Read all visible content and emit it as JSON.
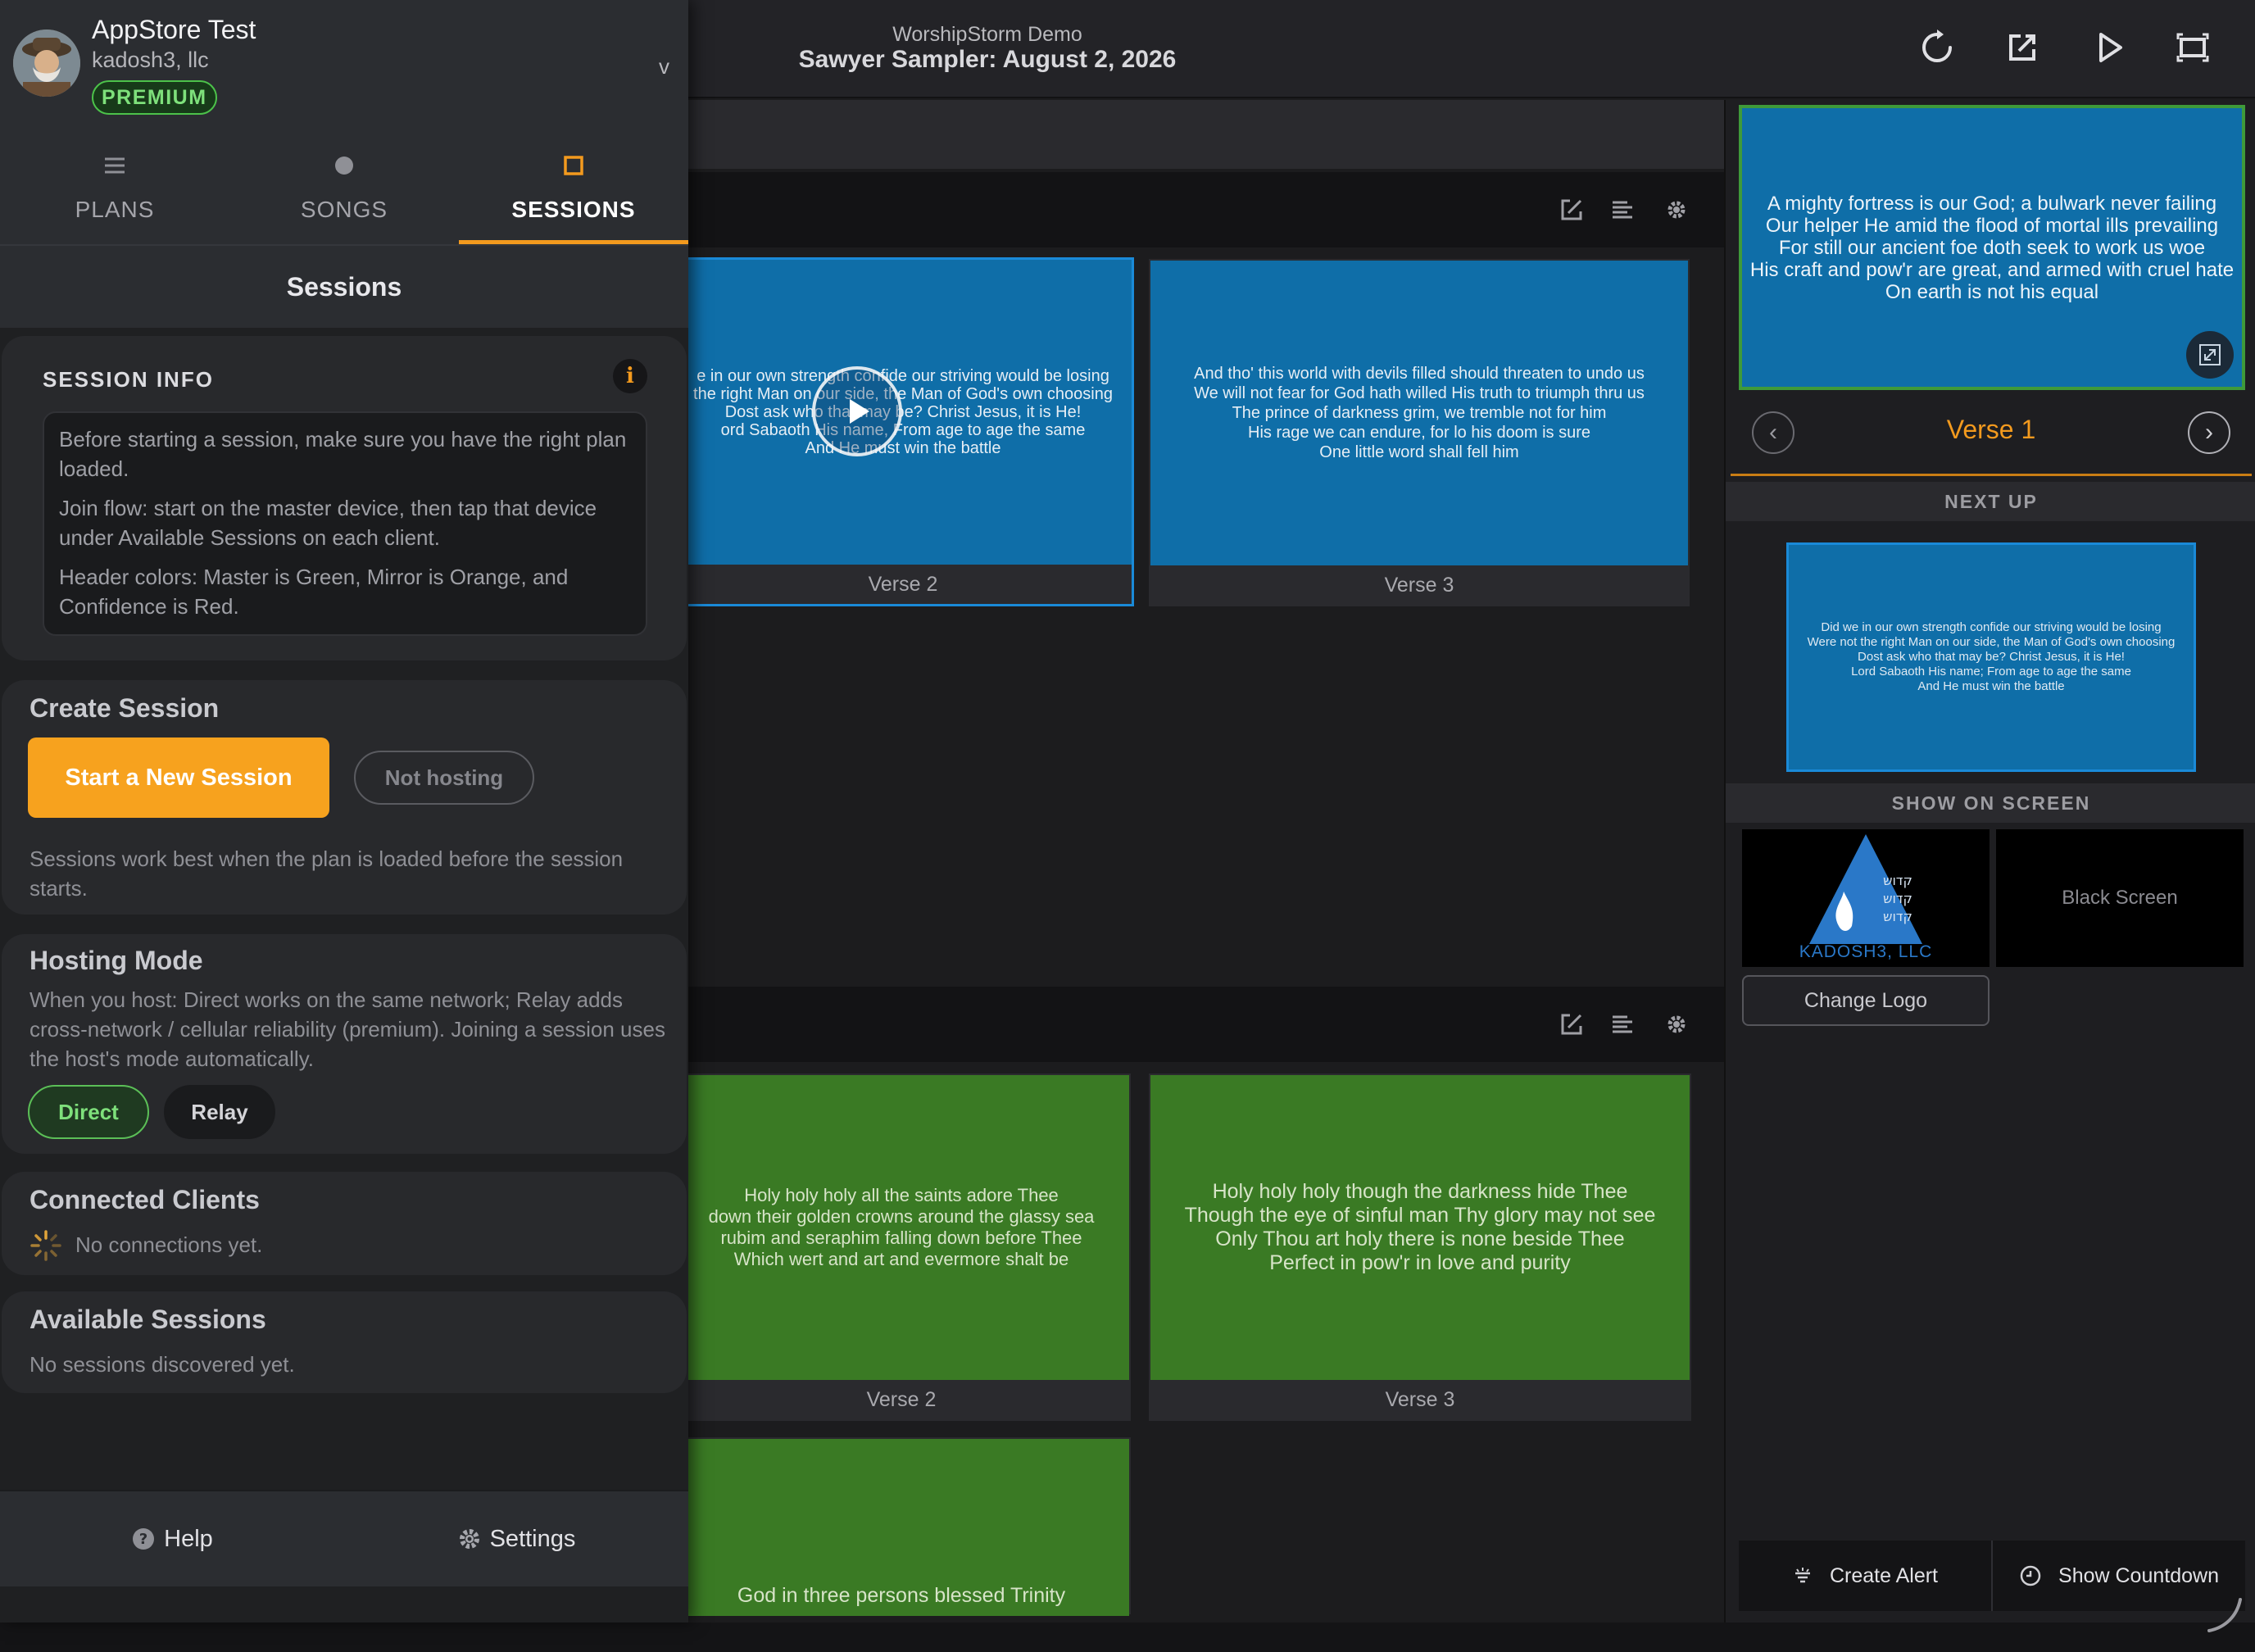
{
  "header": {
    "app_name": "WorshipStorm Demo",
    "plan_title": "Sawyer Sampler: August 2, 2026",
    "actions": [
      {
        "name": "refresh-icon"
      },
      {
        "name": "external-display-icon"
      },
      {
        "name": "play-icon"
      },
      {
        "name": "fit-screen-icon"
      }
    ]
  },
  "account": {
    "name": "AppStore Test",
    "org": "kadosh3, llc",
    "badge": "PREMIUM",
    "chevron": "v"
  },
  "tabs": [
    {
      "label": "PLANS",
      "icon": "list-icon"
    },
    {
      "label": "SONGS",
      "icon": "dot-icon"
    },
    {
      "label": "SESSIONS",
      "icon": "square-icon",
      "active": true
    }
  ],
  "panel": {
    "title": "Sessions"
  },
  "session_info": {
    "heading": "SESSION INFO",
    "info_glyph": "i",
    "paragraphs": [
      "Before starting a session, make sure you have the right plan loaded.",
      "Join flow: start on the master device, then tap that device under Available Sessions on each client.",
      "Header colors: Master is Green, Mirror is Orange, and Confidence is Red."
    ]
  },
  "create_session": {
    "heading": "Create Session",
    "start_label": "Start a New Session",
    "status_label": "Not hosting",
    "note": "Sessions work best when the plan is loaded before the session starts."
  },
  "hosting_mode": {
    "heading": "Hosting Mode",
    "description": "When you host: Direct works on the same network; Relay adds cross-network / cellular reliability (premium). Joining a session uses the host's mode automatically.",
    "options": [
      "Direct",
      "Relay"
    ],
    "selected": "Direct"
  },
  "connected_clients": {
    "heading": "Connected Clients",
    "empty": "No connections yet."
  },
  "available_sessions": {
    "heading": "Available Sessions",
    "empty": "No sessions discovered yet."
  },
  "footer": {
    "help_label": "Help",
    "settings_label": "Settings"
  },
  "songs": [
    {
      "slides": [
        {
          "label": "Verse 2",
          "text": "e in our own strength confide our striving would be losing\n the right Man on our side, the Man of God's own choosing\n Dost ask who that may be? Christ Jesus, it is He!\nord Sabaoth His name, From age to age the same\nAnd He must win the battle",
          "active": true
        },
        {
          "label": "Verse 3",
          "text": "And tho' this world with devils filled should threaten to undo us\nWe will not fear for God hath willed His truth to triumph thru us\nThe prince of darkness grim, we tremble not for him\nHis rage we can endure, for lo his doom is sure\nOne little word shall fell him"
        }
      ]
    },
    {
      "slides": [
        {
          "label": "Verse 2",
          "text": "Holy holy holy all the saints adore Thee\n down their golden crowns around the glassy sea\nrubim and seraphim falling down before Thee\nWhich wert and art and evermore shalt be"
        },
        {
          "label": "Verse 3",
          "text": "Holy holy holy though the darkness hide Thee\nThough the eye of sinful man Thy glory may not see\nOnly Thou art holy there is none beside Thee\nPerfect in pow'r in love and purity"
        },
        {
          "label": "",
          "text": "God in three persons blessed Trinity"
        }
      ]
    }
  ],
  "live": {
    "text": "A mighty fortress is our God; a bulwark never failing\nOur helper He amid the flood of mortal ills prevailing\nFor still our ancient foe doth seek to work us woe\nHis craft and pow'r are great, and armed with cruel hate\nOn earth is not his equal",
    "verse_name": "Verse 1",
    "prev_glyph": "‹",
    "next_glyph": "›"
  },
  "next_up": {
    "title": "NEXT UP",
    "text": "Did we in our own strength confide our striving would be losing\nWere not the right Man on our side, the Man of God's own choosing\nDost ask who that may be? Christ Jesus, it is He!\nLord Sabaoth His name; From age to age the same\nAnd He must win the battle"
  },
  "show_on_screen": {
    "title": "SHOW ON SCREEN",
    "logo_caption": "KADOSH3, LLC",
    "logo_hebrew": [
      "קדוש",
      "קדוש",
      "קדוש"
    ],
    "black_label": "Black Screen",
    "change_logo_label": "Change Logo"
  },
  "bottom_actions": {
    "alert_label": "Create Alert",
    "countdown_label": "Show Countdown"
  },
  "colors": {
    "accent": "#f39a1e",
    "premium": "#4cc24a",
    "slide_blue": "#0f6ea8",
    "slide_green": "#3a7a24"
  }
}
